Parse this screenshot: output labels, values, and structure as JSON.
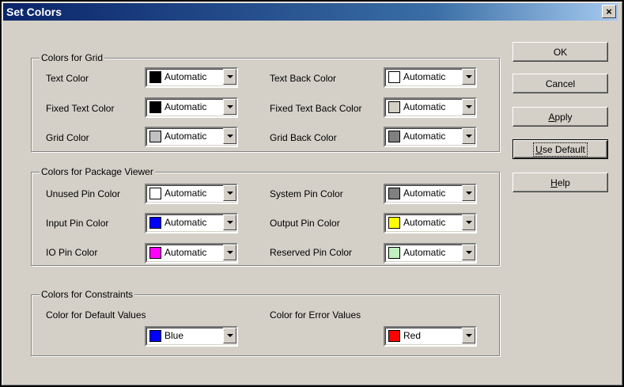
{
  "window": {
    "title": "Set Colors",
    "close_label": "×"
  },
  "groups": {
    "grid": {
      "label": "Colors for Grid",
      "rows": [
        {
          "left_label": "Text Color",
          "left_value": "Automatic",
          "left_color": "#000000",
          "right_label": "Text Back Color",
          "right_value": "Automatic",
          "right_color": "#ffffff"
        },
        {
          "left_label": "Fixed Text Color",
          "left_value": "Automatic",
          "left_color": "#000000",
          "right_label": "Fixed Text Back Color",
          "right_value": "Automatic",
          "right_color": "#d4d0c8"
        },
        {
          "left_label": "Grid Color",
          "left_value": "Automatic",
          "left_color": "#c0c0c0",
          "right_label": "Grid Back Color",
          "right_value": "Automatic",
          "right_color": "#808080"
        }
      ]
    },
    "package": {
      "label": "Colors for Package Viewer",
      "rows": [
        {
          "left_label": "Unused Pin Color",
          "left_value": "Automatic",
          "left_color": "#ffffff",
          "right_label": "System Pin Color",
          "right_value": "Automatic",
          "right_color": "#808080"
        },
        {
          "left_label": "Input Pin Color",
          "left_value": "Automatic",
          "left_color": "#0000ff",
          "right_label": "Output Pin Color",
          "right_value": "Automatic",
          "right_color": "#ffff00"
        },
        {
          "left_label": "IO Pin Color",
          "left_value": "Automatic",
          "left_color": "#ff00ff",
          "right_label": "Reserved Pin Color",
          "right_value": "Automatic",
          "right_color": "#c0f0c0"
        }
      ]
    },
    "constraints": {
      "label": "Colors for Constraints",
      "left_label": "Color for Default Values",
      "left_value": "Blue",
      "left_color": "#0000ff",
      "right_label": "Color for Error Values",
      "right_value": "Red",
      "right_color": "#ff0000"
    }
  },
  "buttons": {
    "ok": "OK",
    "cancel": "Cancel",
    "apply_first": "A",
    "apply_rest": "pply",
    "use_default_first": "U",
    "use_default_rest": "se Default",
    "help_first": "H",
    "help_rest": "elp"
  }
}
